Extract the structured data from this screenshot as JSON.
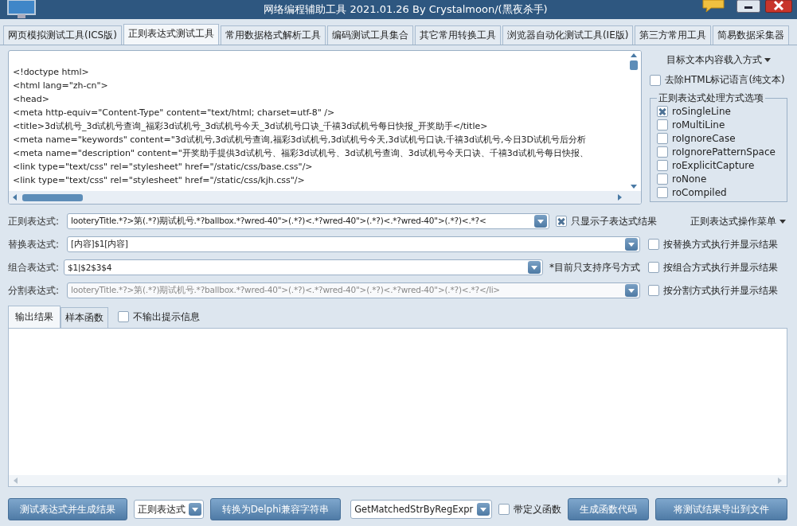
{
  "window": {
    "title": "网络编程辅助工具  2021.01.26  By Crystalmoon/(黑夜杀手)"
  },
  "tabs": [
    {
      "label": "网页模拟测试工具(ICS版)",
      "selected": false
    },
    {
      "label": "正则表达式测试工具",
      "selected": true
    },
    {
      "label": "常用数据格式解析工具",
      "selected": false
    },
    {
      "label": "编码测试工具集合",
      "selected": false
    },
    {
      "label": "其它常用转换工具",
      "selected": false
    },
    {
      "label": "浏览器自动化测试工具(IE版)",
      "selected": false
    },
    {
      "label": "第三方常用工具",
      "selected": false
    },
    {
      "label": "简易数据采集器",
      "selected": false
    }
  ],
  "editor": {
    "lines": [
      "<!doctype html>",
      "<html lang=\"zh-cn\">",
      "<head>",
      "<meta http-equiv=\"Content-Type\" content=\"text/html; charset=utf-8\" />",
      "<title>3d试机号_3d试机号查询_福彩3d试机号_3d试机号今天_3d试机号口诀_千禧3d试机号每日快报_开奖助手</title>",
      "<meta name=\"keywords\" content=\"3d试机号,3d试机号查询,福彩3d试机号,3d试机号今天,3d试机号口诀,千禧3d试机号,今日3D试机号后分析",
      "<meta name=\"description\" content=\"开奖助手提供3d试机号、福彩3d试机号、3d试机号查询、3d试机号今天口诀、千禧3d试机号每日快报、",
      "<link type=\"text/css\" rel=\"stylesheet\" href=\"/static/css/base.css\"/>",
      "<link type=\"text/css\" rel=\"stylesheet\" href=\"/static/css/kjh.css\"/>"
    ]
  },
  "side": {
    "load_menu": "目标文本内容载入方式",
    "strip_html": {
      "label": "去除HTML标记语言(纯文本)",
      "checked": false
    },
    "options": {
      "title": "正则表达式处理方式选项",
      "items": [
        {
          "label": "roSingleLine",
          "checked": true
        },
        {
          "label": "roMultiLine",
          "checked": false
        },
        {
          "label": "roIgnoreCase",
          "checked": false
        },
        {
          "label": "roIgnorePatternSpace",
          "checked": false
        },
        {
          "label": "roExplicitCapture",
          "checked": false
        },
        {
          "label": "roNone",
          "checked": false
        },
        {
          "label": "roCompiled",
          "checked": false
        }
      ]
    }
  },
  "rows": [
    {
      "label": "正则表达式:",
      "value": "looteryTitle.*?>第(.*?)期试机号.*?ballbox.*?wred-40\">(.*?)<.*?wred-40\">(.*?)<.*?wred-40\">(.*?)<.*?<",
      "disabled": false,
      "side": {
        "kind": "checkbox",
        "label": "只显示子表达式结果",
        "checked": true
      },
      "right": {
        "kind": "menu",
        "label": "正则表达式操作菜单"
      }
    },
    {
      "label": "替换表达式:",
      "value": "[内容]$1[内容]",
      "disabled": false,
      "right": {
        "kind": "checkbox",
        "label": "按替换方式执行并显示结果",
        "checked": false
      }
    },
    {
      "label": "组合表达式:",
      "value": "$1|$2$3$4",
      "disabled": false,
      "side": {
        "kind": "note",
        "label": "*目前只支持序号方式"
      },
      "right": {
        "kind": "checkbox",
        "label": "按组合方式执行并显示结果",
        "checked": false
      }
    },
    {
      "label": "分割表达式:",
      "value": "looteryTitle.*?>第(.*?)期试机号.*?ballbox.*?wred-40\">(.*?)<.*?wred-40\">(.*?)<.*?wred-40\">(.*?)<.*?</li>",
      "disabled": true,
      "right": {
        "kind": "checkbox",
        "label": "按分割方式执行并显示结果",
        "checked": false
      }
    }
  ],
  "output": {
    "tabs": [
      {
        "label": "输出结果",
        "selected": true
      },
      {
        "label": "样本函数",
        "selected": false
      }
    ],
    "no_hint": {
      "label": "不输出提示信息",
      "checked": false
    }
  },
  "toolbar": [
    {
      "kind": "button",
      "label": "测试表达式并生成结果"
    },
    {
      "kind": "combo",
      "value": "正则表达式"
    },
    {
      "kind": "button",
      "label": "转换为Delphi兼容字符串"
    },
    {
      "kind": "combo",
      "value": "GetMatchedStrByRegExpr"
    },
    {
      "kind": "checkbox",
      "label": "带定义函数",
      "checked": false
    },
    {
      "kind": "button",
      "label": "生成函数代码"
    },
    {
      "kind": "button",
      "label": "将测试结果导出到文件"
    }
  ]
}
